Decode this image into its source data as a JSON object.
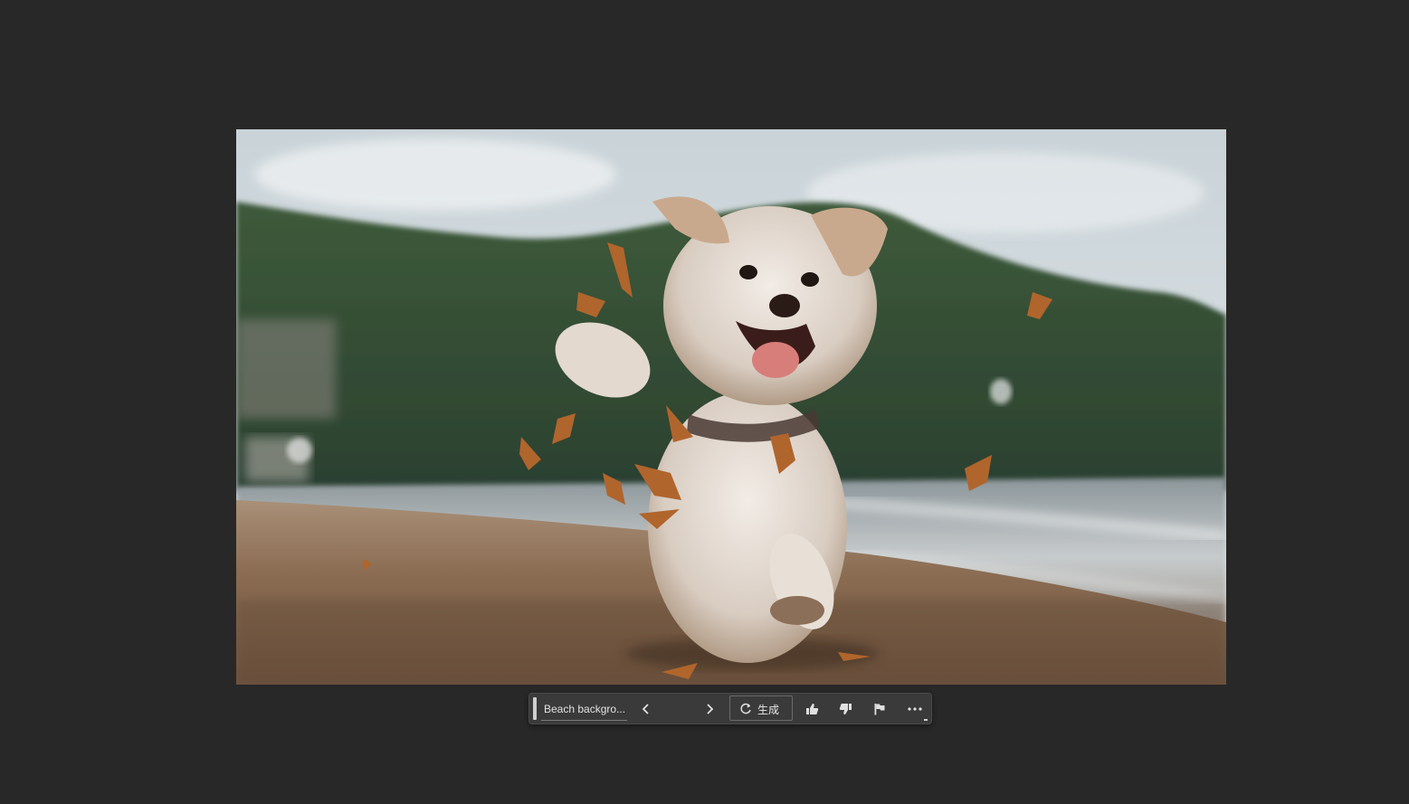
{
  "canvas": {
    "image_subject": "Photo of a fluffy white dog running on a beach with autumn leaves, green hills and sea in the background"
  },
  "context_bar": {
    "prompt_value": "Beach backgro...",
    "generate_label": "生成",
    "icons": [
      "grip-handle-icon",
      "chevron-left-icon",
      "chevron-right-icon",
      "refresh-icon",
      "thumbs-up-icon",
      "thumbs-down-icon",
      "flag-icon",
      "more-options-icon"
    ]
  },
  "colors": {
    "workspace_bg": "#282828",
    "bar_bg": "#3a3a3a",
    "icon": "#e0e0e0"
  }
}
